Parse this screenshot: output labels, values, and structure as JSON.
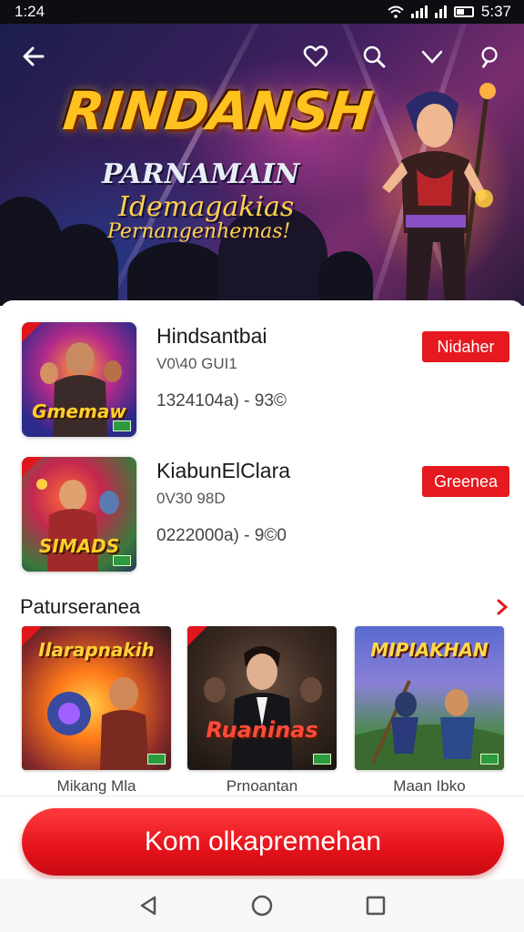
{
  "status_bar": {
    "time": "1:24",
    "clock_right": "5:37"
  },
  "hero": {
    "title": "RINDANSH",
    "subtitle_1": "PARNAMAIN",
    "subtitle_2": "Idemagakias",
    "subtitle_3": "Pernangenhemas!",
    "icons": [
      "back-arrow-icon",
      "heart-icon",
      "search-icon",
      "chevron-down-icon",
      "search-icon"
    ]
  },
  "games": [
    {
      "title": "Hindsantbai",
      "meta": "V0\\40 GUI1",
      "stats": "1324104a) - 93©",
      "button": "Nidaher",
      "thumb_label": "Gmemaw"
    },
    {
      "title": "KiabunElClara",
      "meta": "0V30 98D",
      "stats": "0222000a) - 9©0",
      "button": "Greenea",
      "thumb_label": "SIMADS"
    }
  ],
  "featured": {
    "section_title": "Paturseranea",
    "items": [
      {
        "name": "Mikang Mla",
        "thumb_title": "Ilarapnakih"
      },
      {
        "name": "Prnoantan",
        "thumb_title": "Ruaninas"
      },
      {
        "name": "Maan Ibko",
        "thumb_title": "MIPIAKHAN"
      }
    ]
  },
  "cta": {
    "label": "Kom olkapremehan"
  },
  "colors": {
    "accent": "#e5191f",
    "hero_title": "#ffc21f"
  }
}
